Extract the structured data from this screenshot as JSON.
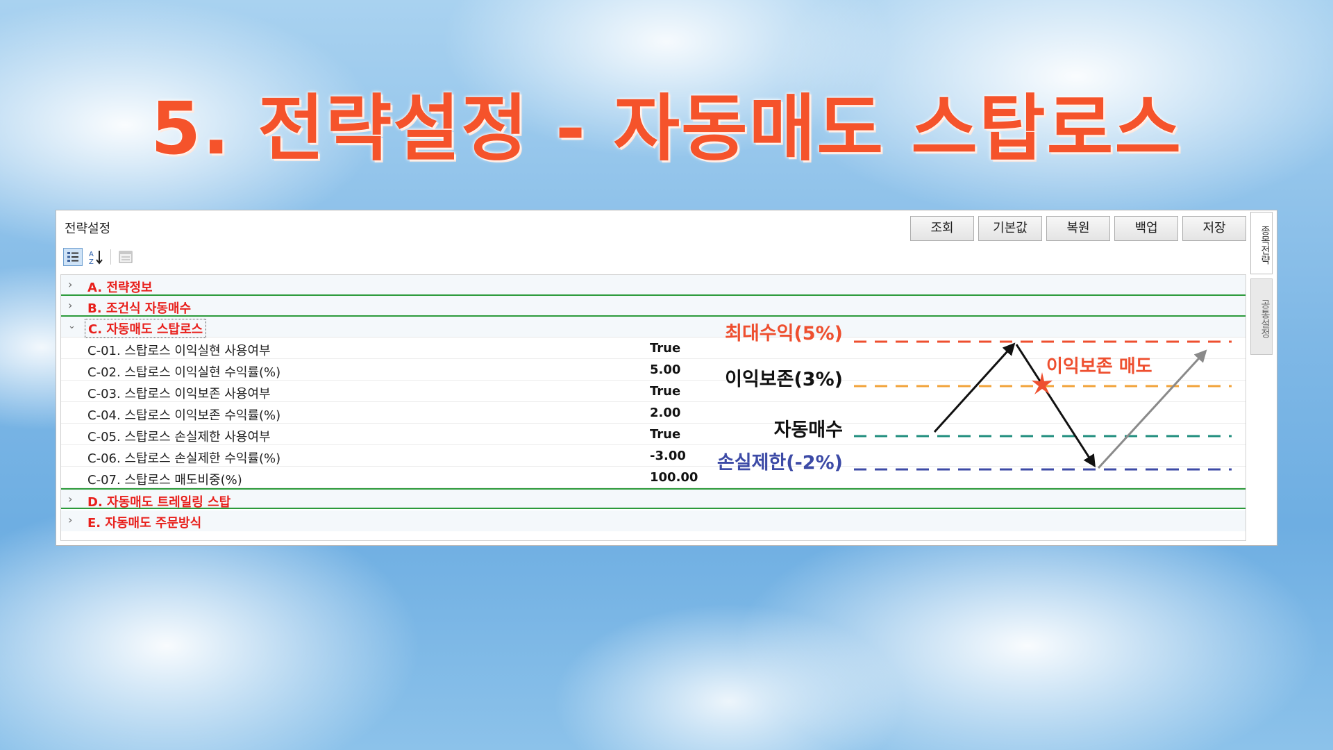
{
  "title": "5. 전략설정 - 자동매도 스탑로스",
  "panel": {
    "title": "전략설정",
    "buttons": [
      "조회",
      "기본값",
      "복원",
      "백업",
      "저장"
    ],
    "toolbar_icons": [
      "categorized-icon",
      "sort-alphabetical-icon",
      "property-pages-icon"
    ],
    "side_tabs": [
      "종목전략",
      "공통설정"
    ]
  },
  "categories": [
    {
      "label": "A. 전략정보",
      "expanded": false
    },
    {
      "label": "B. 조건식 자동매수",
      "expanded": false
    },
    {
      "label": "C. 자동매도 스탑로스",
      "expanded": true
    },
    {
      "label": "D. 자동매도 트레일링 스탑",
      "expanded": false
    },
    {
      "label": "E. 자동매도 주문방식",
      "expanded": false
    }
  ],
  "properties": [
    {
      "name": "C-01. 스탑로스 이익실현 사용여부",
      "value": "True"
    },
    {
      "name": "C-02. 스탑로스 이익실현 수익률(%)",
      "value": "5.00"
    },
    {
      "name": "C-03. 스탑로스 이익보존 사용여부",
      "value": "True"
    },
    {
      "name": "C-04. 스탑로스 이익보존 수익률(%)",
      "value": "2.00"
    },
    {
      "name": "C-05. 스탑로스 손실제한 사용여부",
      "value": "True"
    },
    {
      "name": "C-06. 스탑로스 손실제한 수익률(%)",
      "value": "-3.00"
    },
    {
      "name": "C-07. 스탑로스 매도비중(%)",
      "value": "100.00"
    }
  ],
  "diagram": {
    "levels": [
      {
        "label": "최대수익(5%)",
        "color": "#ee4f2f",
        "level": 5
      },
      {
        "label": "이익보존(3%)",
        "color": "#f2a33a",
        "level": 3
      },
      {
        "label": "자동매수",
        "color": "#1f8e7e",
        "level": 0
      },
      {
        "label": "손실제한(-2%)",
        "color": "#3c4aa6",
        "level": -2
      }
    ],
    "annotation": "이익보존 매도",
    "annotation_color": "#ee4f2f",
    "marker": "sell-star-icon"
  },
  "colors": {
    "title": "#f5532b",
    "category_label": "#e8201c",
    "category_divider": "#2b9a3a"
  }
}
